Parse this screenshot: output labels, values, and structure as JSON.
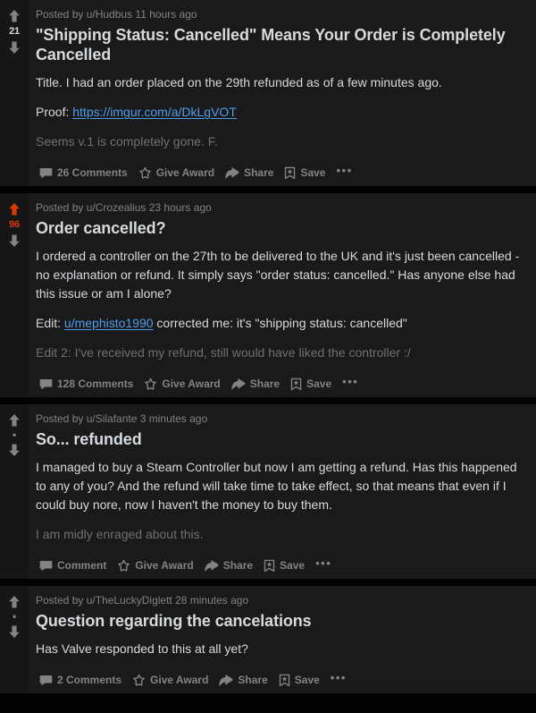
{
  "theme": {
    "page_background": "#030303",
    "post_background": "#1a1a1b",
    "vote_column_background": "#161617",
    "primary_text": "#d7dadc",
    "meta_text": "#818384",
    "faded_text": "#6e7071",
    "link_color": "#4f9eed",
    "upvoted_color": "#d93900"
  },
  "posts": [
    {
      "byline": "Posted by u/Hudbus 11 hours ago",
      "title": "\"Shipping Status: Cancelled\" Means Your Order is Completely Cancelled",
      "score": "21",
      "vote_state": "none",
      "body": {
        "p1": "Title. I had an order placed on the 29th refunded as of a few minutes ago.",
        "p2_label": "Proof: ",
        "p2_link": "https://imgur.com/a/DkLgVOT",
        "p3_faded": "Seems v.1 is completely gone. F."
      },
      "actions": {
        "comments": "26 Comments",
        "award": "Give Award",
        "share": "Share",
        "save": "Save",
        "more": "•••"
      }
    },
    {
      "byline": "Posted by u/Crozealius 23 hours ago",
      "title": "Order cancelled?",
      "score": "96",
      "vote_state": "upvoted",
      "body": {
        "p1": "I ordered a controller on the 27th to be delivered to the UK and it's just been cancelled - no explanation or refund. It simply says \"order status: cancelled.\" Has anyone else had this issue or am I alone?",
        "p2_label": "Edit: ",
        "p2_link": "u/mephisto1990",
        "p2_rest": " corrected me: it's \"shipping status: cancelled\"",
        "p3_faded": "Edit 2: I've received my refund, still would have liked the controller :/"
      },
      "actions": {
        "comments": "128 Comments",
        "award": "Give Award",
        "share": "Share",
        "save": "Save",
        "more": "•••"
      }
    },
    {
      "byline": "Posted by u/Silafante 3 minutes ago",
      "title": "So... refunded",
      "score": "•",
      "vote_state": "hidden",
      "body": {
        "p1": "I managed to buy a Steam Controller but now I am getting a refund. Has this happened to any of you? And the refund will take time to take effect, so that means that even if I could buy nore, now I haven't the money to buy them.",
        "p3_faded": "I am midly enraged about this."
      },
      "actions": {
        "comments": "Comment",
        "award": "Give Award",
        "share": "Share",
        "save": "Save",
        "more": "•••"
      }
    },
    {
      "byline": "Posted by u/TheLuckyDiglett 28 minutes ago",
      "title": "Question regarding the cancelations",
      "score": "•",
      "vote_state": "hidden",
      "body": {
        "p1": "Has Valve responded to this at all yet?"
      },
      "actions": {
        "comments": "2 Comments",
        "award": "Give Award",
        "share": "Share",
        "save": "Save",
        "more": "•••"
      }
    }
  ],
  "icons": {
    "upvote": "upvote-arrow-icon",
    "downvote": "downvote-arrow-icon",
    "comment": "comment-bubble-icon",
    "award": "award-star-icon",
    "share": "share-arrow-icon",
    "save": "save-bookmark-icon",
    "more": "more-options-icon"
  }
}
